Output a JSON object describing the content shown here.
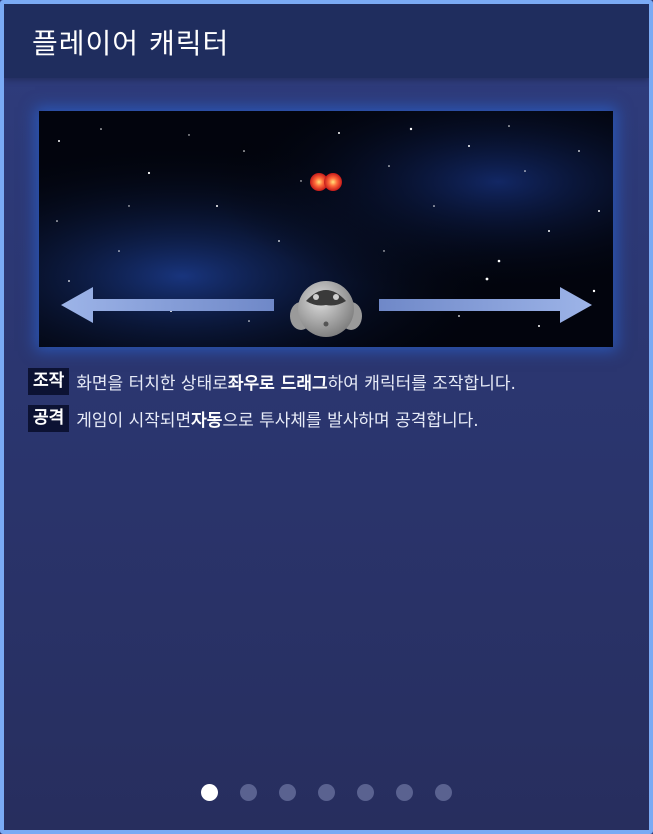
{
  "header": {
    "title": "플레이어 캐릭터"
  },
  "instructions": [
    {
      "tag": "조작",
      "parts": [
        {
          "text": "화면을 터치한 상태로 ",
          "bold": false
        },
        {
          "text": "좌우로 드래그",
          "bold": true
        },
        {
          "text": "하여 캐릭터를 조작합니다.",
          "bold": false
        }
      ]
    },
    {
      "tag": "공격",
      "parts": [
        {
          "text": "게임이 시작되면 ",
          "bold": false
        },
        {
          "text": "자동",
          "bold": true
        },
        {
          "text": "으로 투사체를 발사하며 공격합니다.",
          "bold": false
        }
      ]
    }
  ],
  "preview": {
    "icons": [
      "left-arrow-icon",
      "right-arrow-icon",
      "player-character-icon",
      "projectile-icon"
    ]
  },
  "pagination": {
    "total": 7,
    "active": 0
  },
  "colors": {
    "border": "#7aaaf4",
    "header": "#1f2d5e",
    "tag_bg": "#0c1233",
    "dot_active": "#ffffff",
    "dot_inactive": "#5a6290"
  }
}
